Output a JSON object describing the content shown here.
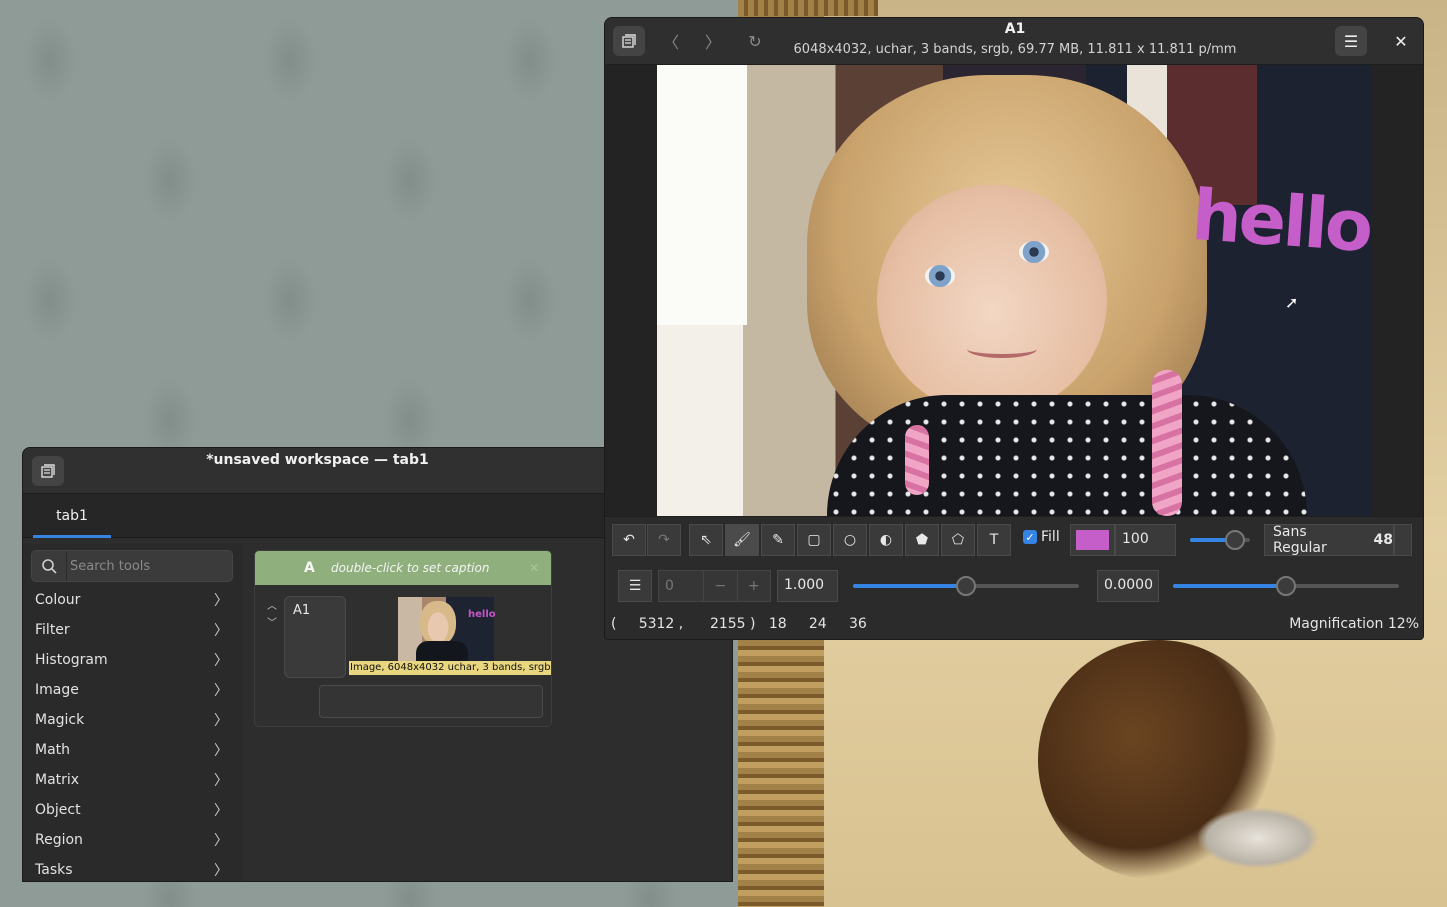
{
  "viewer": {
    "title": "A1",
    "subtitle": "6048x4032,  uchar, 3 bands, srgb, 69.77 MB, 11.811 x 11.811 p/mm",
    "photo_text": "hello",
    "toolbar": {
      "fill_label": "Fill",
      "fill_checked": true,
      "ink_color": "#c55ec9",
      "ink_value": "100",
      "font_name": "Sans Regular",
      "font_size": "48",
      "brush_slider_fraction": 0.75
    },
    "toolbar2": {
      "page_value": "0",
      "minus_label": "−",
      "plus_label": "+",
      "scale_value": "1.000",
      "scale_slider_fraction": 0.5,
      "offset_value": "0.0000",
      "offset_slider_fraction": 0.5
    },
    "status": {
      "coords": "(     5312 ,      2155 )   18     24     36",
      "magnification": "Magnification 12%"
    }
  },
  "workspace": {
    "title": "*unsaved workspace — tab1",
    "tab_label": "tab1",
    "search_placeholder": "Search tools",
    "categories": [
      "Colour",
      "Filter",
      "Histogram",
      "Image",
      "Magick",
      "Math",
      "Matrix",
      "Object",
      "Region",
      "Tasks"
    ],
    "node": {
      "letter": "A",
      "caption": "double-click to set caption",
      "name": "A1",
      "thumb_text": "hello",
      "image_label": "Image, 6048x4032 uchar, 3 bands, srgb"
    }
  },
  "colors": {
    "accent": "#3584e4",
    "node_header": "#8fb07d",
    "label_bg": "#e9d77f"
  }
}
